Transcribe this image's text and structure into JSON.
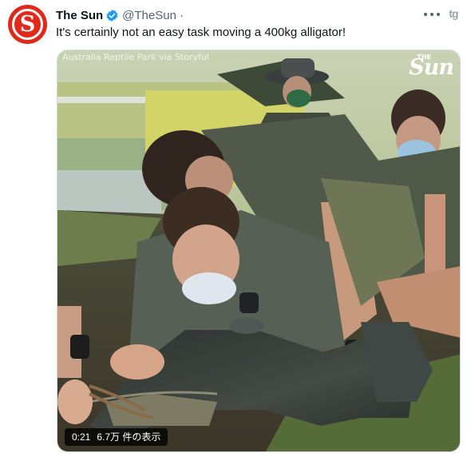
{
  "tweet": {
    "display_name": "The Sun",
    "handle": "@TheSun",
    "separator": "·",
    "text": "It's certainly not an easy task moving a 400kg alligator!",
    "avatar_letter": "S",
    "tag_icon_text": "tg",
    "colors": {
      "brand": "#e0291a",
      "verified": "#1d9bf0",
      "secondary_text": "#536471"
    }
  },
  "media": {
    "credit": "Australia Reptile Park via Storyful",
    "watermark_small": "THE",
    "watermark_big": "Sun",
    "duration": "0:21",
    "views": "6.7万 件の表示"
  },
  "icons": [
    "more-icon",
    "verified-badge-icon",
    "tg-icon"
  ]
}
